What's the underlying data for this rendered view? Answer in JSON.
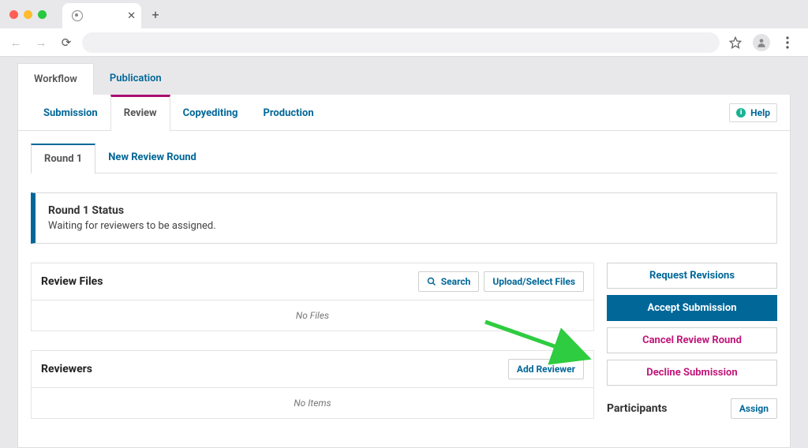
{
  "outerTabs": {
    "workflow": "Workflow",
    "publication": "Publication"
  },
  "innerTabs": {
    "submission": "Submission",
    "review": "Review",
    "copyediting": "Copyediting",
    "production": "Production"
  },
  "help": "Help",
  "roundTabs": {
    "round1": "Round 1",
    "newRound": "New Review Round"
  },
  "status": {
    "title": "Round 1 Status",
    "message": "Waiting for reviewers to be assigned."
  },
  "reviewFiles": {
    "title": "Review Files",
    "search": "Search",
    "upload": "Upload/Select Files",
    "empty": "No Files"
  },
  "reviewers": {
    "title": "Reviewers",
    "add": "Add Reviewer",
    "empty": "No Items"
  },
  "actions": {
    "requestRevisions": "Request Revisions",
    "accept": "Accept Submission",
    "cancelRound": "Cancel Review Round",
    "decline": "Decline Submission"
  },
  "participants": {
    "title": "Participants",
    "assign": "Assign"
  }
}
